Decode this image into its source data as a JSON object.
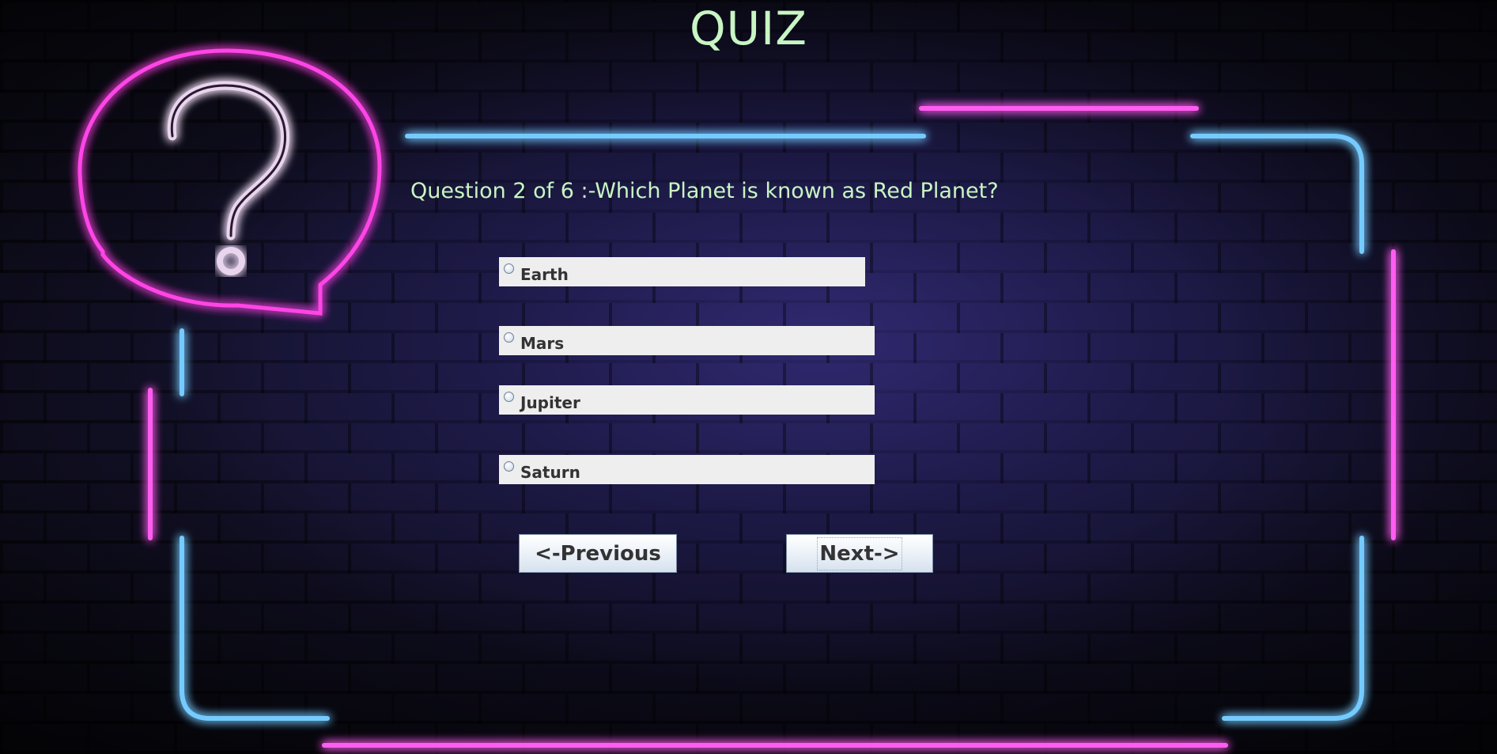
{
  "window": {
    "title": "QUIZ"
  },
  "quiz": {
    "question_text": "Question 2 of 6 :-Which Planet is known as Red Planet?",
    "current_question": 2,
    "total_questions": 6,
    "options": [
      {
        "label": "Earth",
        "selected": false
      },
      {
        "label": "Mars",
        "selected": false
      },
      {
        "label": "Jupiter",
        "selected": false
      },
      {
        "label": "Saturn",
        "selected": false
      }
    ]
  },
  "navigation": {
    "previous_label": "<-Previous",
    "next_label": "Next->"
  },
  "icons": {
    "decor": "question-mark-speech-bubble-icon",
    "radio": "radio-button-icon"
  },
  "colors": {
    "title": "#c8f5c4",
    "neon_pink": "#ff3df2",
    "neon_blue": "#4fb8ff",
    "option_bg": "#eeeeee",
    "option_text": "#333333"
  }
}
